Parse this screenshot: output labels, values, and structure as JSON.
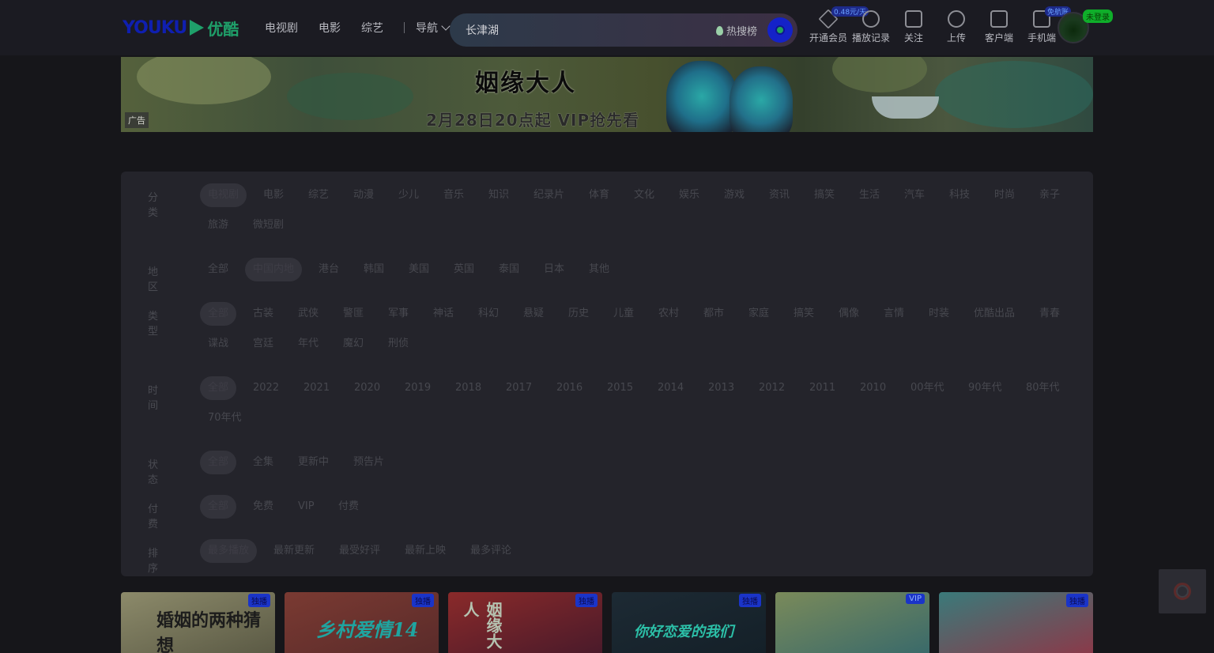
{
  "header": {
    "logo_en": "YOUKU",
    "logo_cn": "优酷",
    "nav": [
      "电视剧",
      "电影",
      "综艺"
    ],
    "nav_more": "导航"
  },
  "search": {
    "value": "长津湖",
    "hot_label": "热搜榜"
  },
  "tools": [
    {
      "label": "开通会员",
      "badge": "0.48元/天"
    },
    {
      "label": "播放记录",
      "badge": ""
    },
    {
      "label": "关注",
      "badge": ""
    },
    {
      "label": "上传",
      "badge": ""
    },
    {
      "label": "客户端",
      "badge": ""
    },
    {
      "label": "手机端",
      "badge": "免航账"
    }
  ],
  "avatar_badge": "未登录",
  "banner": {
    "title": "姻缘大人",
    "subtitle": "2月28日20点起 VIP抢先看",
    "ad_label": "广告"
  },
  "filters": [
    {
      "label": "分类",
      "options": [
        "电视剧",
        "电影",
        "综艺",
        "动漫",
        "少儿",
        "音乐",
        "知识",
        "纪录片",
        "体育",
        "文化",
        "娱乐",
        "游戏",
        "资讯",
        "搞笑",
        "生活",
        "汽车",
        "科技",
        "时尚",
        "亲子",
        "旅游",
        "微短剧"
      ],
      "selected": 0
    },
    {
      "label": "地区",
      "options": [
        "全部",
        "中国内地",
        "港台",
        "韩国",
        "美国",
        "英国",
        "泰国",
        "日本",
        "其他"
      ],
      "selected": 1
    },
    {
      "label": "类型",
      "options": [
        "全部",
        "古装",
        "武侠",
        "警匪",
        "军事",
        "神话",
        "科幻",
        "悬疑",
        "历史",
        "儿童",
        "农村",
        "都市",
        "家庭",
        "搞笑",
        "偶像",
        "言情",
        "时装",
        "优酷出品",
        "青春",
        "谍战",
        "宫廷",
        "年代",
        "魔幻",
        "刑侦"
      ],
      "selected": 0
    },
    {
      "label": "时间",
      "options": [
        "全部",
        "2022",
        "2021",
        "2020",
        "2019",
        "2018",
        "2017",
        "2016",
        "2015",
        "2014",
        "2013",
        "2012",
        "2011",
        "2010",
        "00年代",
        "90年代",
        "80年代",
        "70年代"
      ],
      "selected": 0
    },
    {
      "label": "状态",
      "options": [
        "全部",
        "全集",
        "更新中",
        "预告片"
      ],
      "selected": 0
    },
    {
      "label": "付费",
      "options": [
        "全部",
        "免费",
        "VIP",
        "付费"
      ],
      "selected": 0
    },
    {
      "label": "排序",
      "options": [
        "最多播放",
        "最新更新",
        "最受好评",
        "最新上映",
        "最多评论"
      ],
      "selected": 0
    }
  ],
  "cards": [
    {
      "title": "婚姻的两种猜想",
      "tag": "独播"
    },
    {
      "title": "乡村爱情14",
      "tag": "独播"
    },
    {
      "title": "姻缘大人",
      "tag": "独播"
    },
    {
      "title": "你好恋爱的我们",
      "tag": "独播"
    },
    {
      "title": "",
      "tag": "VIP"
    },
    {
      "title": "",
      "tag": "独播"
    }
  ]
}
